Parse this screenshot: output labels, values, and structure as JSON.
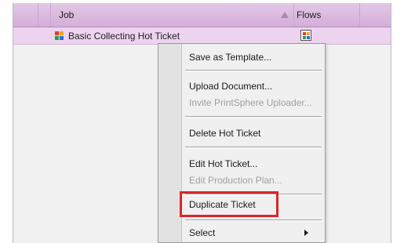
{
  "grid": {
    "columns": [
      {
        "label": "Job",
        "sort": "ascending"
      },
      {
        "label": "Flows"
      }
    ],
    "rows": [
      {
        "job": "Basic Collecting Hot Ticket",
        "flows_icon": "flow-icon"
      }
    ]
  },
  "context_menu": {
    "items": [
      {
        "label": "Save as Template...",
        "enabled": true
      },
      {
        "label": "Upload Document...",
        "enabled": true
      },
      {
        "label": "Invite PrintSphere Uploader...",
        "enabled": false
      },
      {
        "label": "Delete Hot Ticket",
        "enabled": true
      },
      {
        "label": "Edit Hot Ticket...",
        "enabled": true
      },
      {
        "label": "Edit Production Plan...",
        "enabled": false
      },
      {
        "label": "Duplicate Ticket",
        "enabled": true,
        "highlighted": true
      },
      {
        "label": "Select",
        "enabled": true,
        "submenu": true
      }
    ]
  },
  "colors": {
    "header_bg": "#d4aed8",
    "selected_row_bg": "#ecd3ee",
    "highlight_border": "#d9262c"
  }
}
